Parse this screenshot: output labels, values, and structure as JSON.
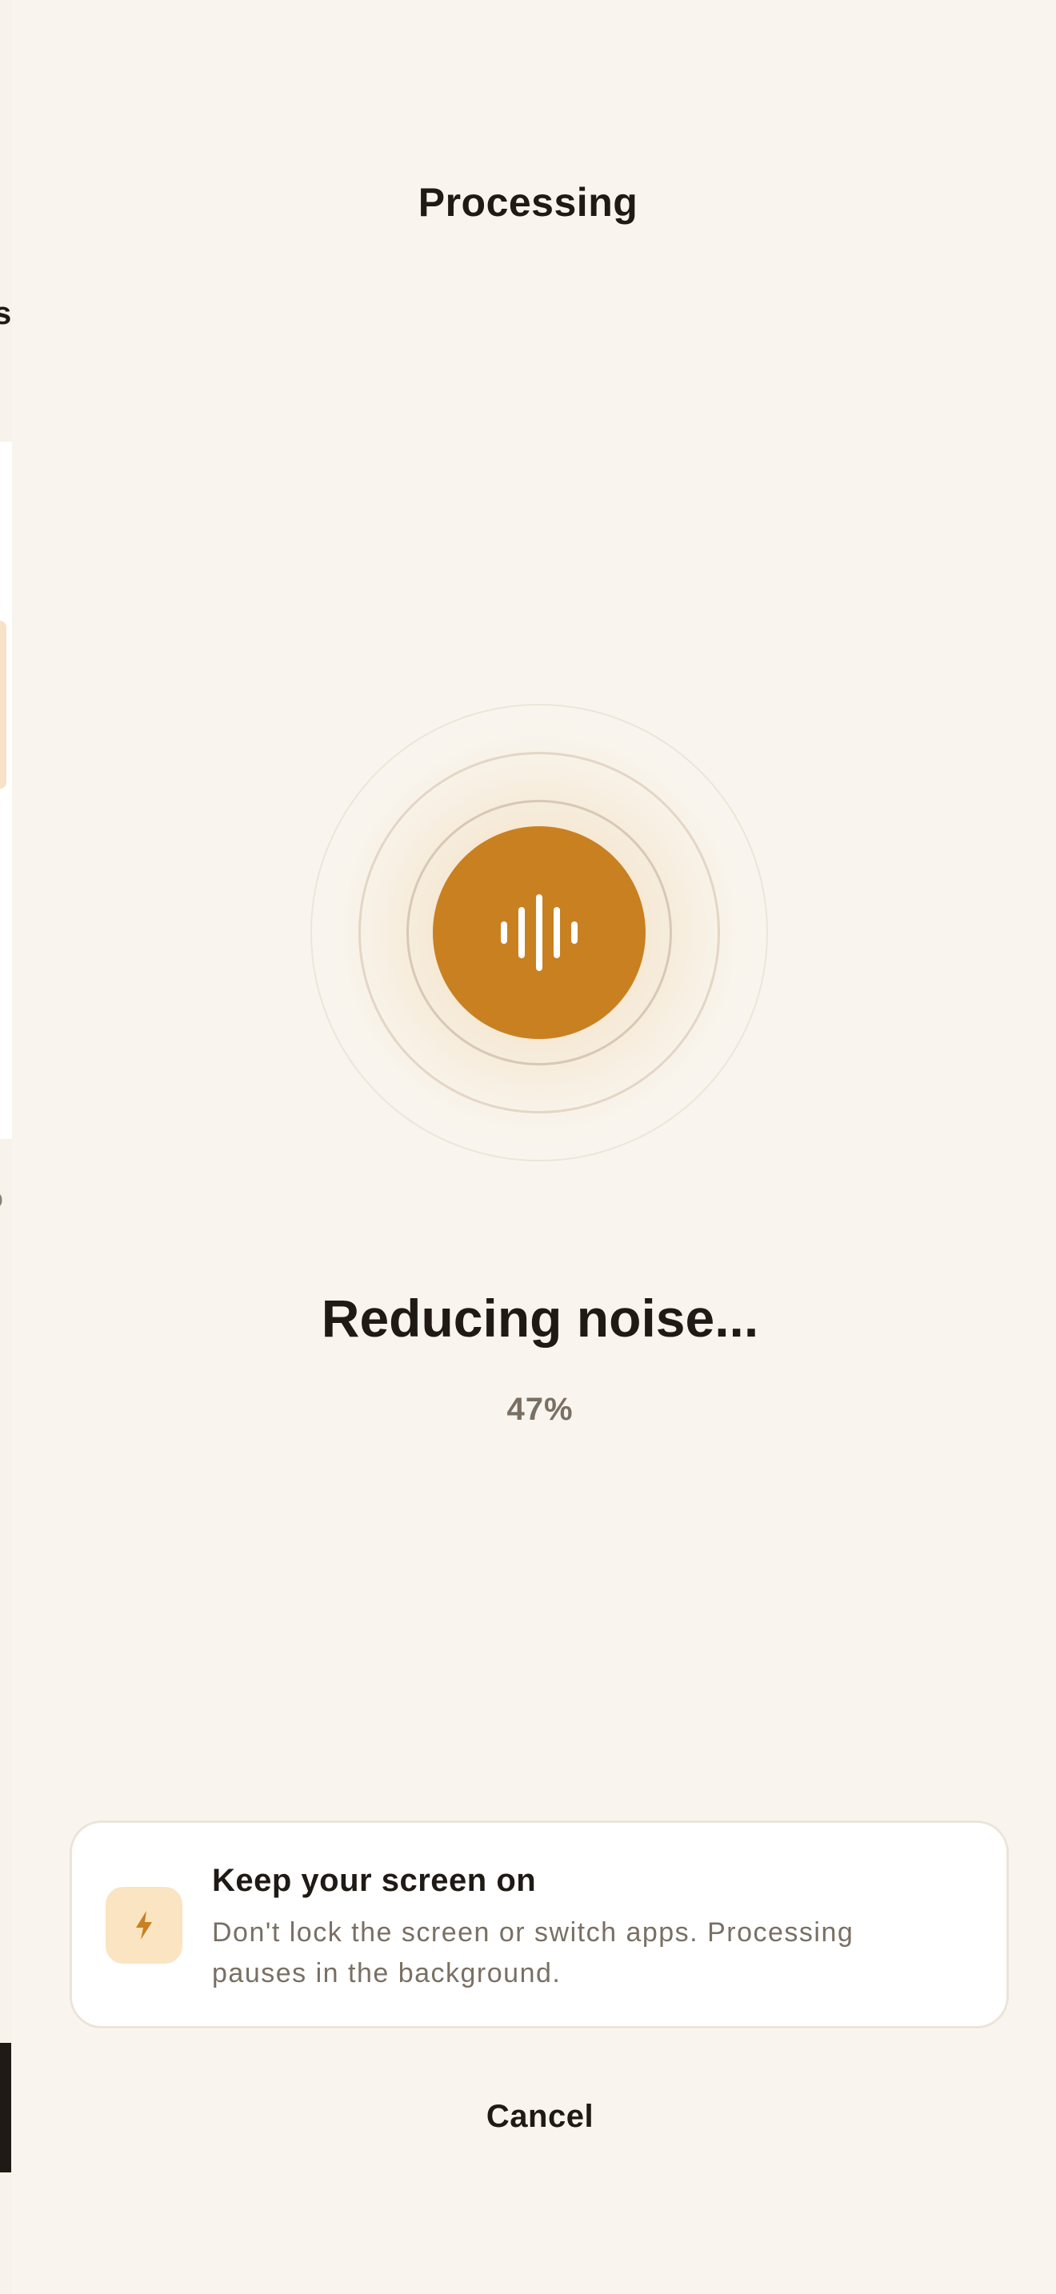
{
  "sheet": {
    "title": "Processing",
    "status_text": "Reducing noise...",
    "progress_label": "47%",
    "progress": 0.47,
    "accent_color": "#c98021",
    "center_icon": "waveform-icon"
  },
  "tip_card": {
    "icon": "bolt-icon",
    "title": "Keep your screen on",
    "body": "Don't lock the screen or switch apps. Processing pauses in the background."
  },
  "actions": {
    "cancel_label": "Cancel"
  }
}
